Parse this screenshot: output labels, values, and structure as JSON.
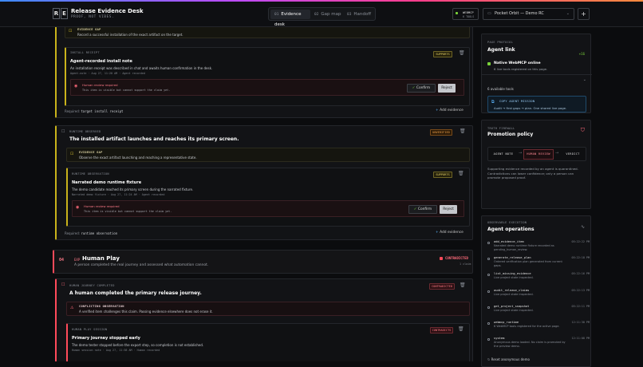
{
  "app": {
    "logo_left": "R",
    "logo_right": "E",
    "title": "Release Evidence Desk",
    "subtitle": "PROOF, NOT VIBES."
  },
  "nav": {
    "tabs": [
      {
        "num": "01",
        "label": "Evidence desk"
      },
      {
        "num": "02",
        "label": "Gap map"
      },
      {
        "num": "03",
        "label": "Handoff"
      }
    ]
  },
  "webmcp": {
    "label": "WEBMCP",
    "tools": "6 TOOLS"
  },
  "session": {
    "selected": "Pocket Orbit — Demo RC",
    "plus": "+"
  },
  "colors": {
    "accent_yellow": "#d8c21e",
    "accent_red": "#ff4a5a",
    "accent_green": "#7ad23a",
    "accent_blue": "#5db7ff"
  },
  "block1": {
    "gap": {
      "label": "EVIDENCE GAP",
      "text": "Record a successful installation of the exact artifact on the target."
    },
    "receipt": {
      "label": "INSTALL RECEIPT",
      "badge": "SUPPORTS",
      "title": "Agent-recorded install note",
      "text": "An installation receipt was described in chat and awaits human confirmation in the desk.",
      "meta": "Agent-note · Aug 27, 11:20 AM · Agent recorded",
      "review_title": "Human review required",
      "review_text": "This item is visible but cannot support the claim yet.",
      "confirm": "Confirm",
      "reject": "Reject"
    },
    "required_prefix": "Required:",
    "required": "target install receipt",
    "add": "Add evidence"
  },
  "block2": {
    "label": "RUNTIME OBSERVED",
    "badge": "UNVERIFIED",
    "title": "The installed artifact launches and reaches its primary screen.",
    "gap": {
      "label": "EVIDENCE GAP",
      "text": "Observe the exact artifact launching and reaching a representative state."
    },
    "obs": {
      "label": "RUNTIME OBSERVATION",
      "badge": "SUPPORTS",
      "title": "Narrated demo runtime fixture",
      "text": "The demo candidate reached its primary screen during the narrated fixture.",
      "meta": "Narrated demo fixture · Aug 27, 11:24 AM · Agent recorded",
      "review_title": "Human review required",
      "review_text": "This item is visible but cannot support the claim yet.",
      "confirm": "Confirm",
      "reject": "Reject"
    },
    "required_prefix": "Required:",
    "required": "runtime observation",
    "add": "Add evidence"
  },
  "section04": {
    "num": "04",
    "tag": "EXP",
    "title": "Human Play",
    "desc": "A person completed the real journey and assessed what automation cannot.",
    "status": "CONTRADICTED",
    "count": "1 claim"
  },
  "block3": {
    "label": "HUMAN JOURNEY COMPLETED",
    "badge": "CONTRADICTED",
    "title": "A human completed the primary release journey.",
    "conflict": {
      "label": "CONFLICTING OBSERVATION",
      "text": "A verified item challenges this claim. Passing evidence elsewhere does not erase it."
    },
    "play": {
      "label": "HUMAN PLAY SESSION",
      "badge": "CONTRADICTS",
      "title": "Primary journey stopped early",
      "text": "The demo tester stopped before the export step, so completion is not established.",
      "meta": "Human session note · Aug 27, 11:38 AM · Human recorded"
    }
  },
  "sidebar": {
    "protocol": {
      "label": "PAGE PROTOCOL",
      "title": "Agent link",
      "count": "+16",
      "status_title": "Native WebMCP online",
      "status_text": "6 live tools registered on this page.",
      "tools_label": "6 available tools",
      "copy_label": "COPY AGENT MISSION",
      "copy_text": "Audit → first gaps → plan. One shared live page."
    },
    "firewall": {
      "label": "TRUTH FIREWALL",
      "title": "Promotion policy",
      "steps": [
        "AGENT NOTE",
        "HUMAN REVIEW",
        "VERDICT"
      ],
      "text": "Supporting evidence recorded by an agent is quarantined. Contradictions can lower confidence; only a person can promote proposed proof."
    },
    "ops": {
      "label": "OBSERVABLE EXECUTION",
      "title": "Agent operations",
      "items": [
        {
          "name": "add_evidence_item",
          "desc": "Narrated demo runtime fixture recorded as pending_human_review.",
          "time": "05:22:22 PM"
        },
        {
          "name": "generate_release_plan",
          "desc": "Ordered verification plan generated from current gaps.",
          "time": "05:22:18 PM"
        },
        {
          "name": "list_missing_evidence",
          "desc": "Live project state inspected.",
          "time": "05:22:16 PM"
        },
        {
          "name": "audit_release_claims",
          "desc": "Live project state inspected.",
          "time": "05:22:13 PM"
        },
        {
          "name": "get_project_snapshot",
          "desc": "Live project state inspected.",
          "time": "05:22:11 PM"
        },
        {
          "name": "webmcp_runtime",
          "desc": "6 WebMCP tools registered for the active page.",
          "time": "12:11:38 PM"
        },
        {
          "name": "system",
          "desc": "Anonymous demo loaded. No claim is promoted by the preview demo.",
          "time": "12:11:08 PM"
        }
      ],
      "reset": "Reset anonymous demo"
    }
  }
}
